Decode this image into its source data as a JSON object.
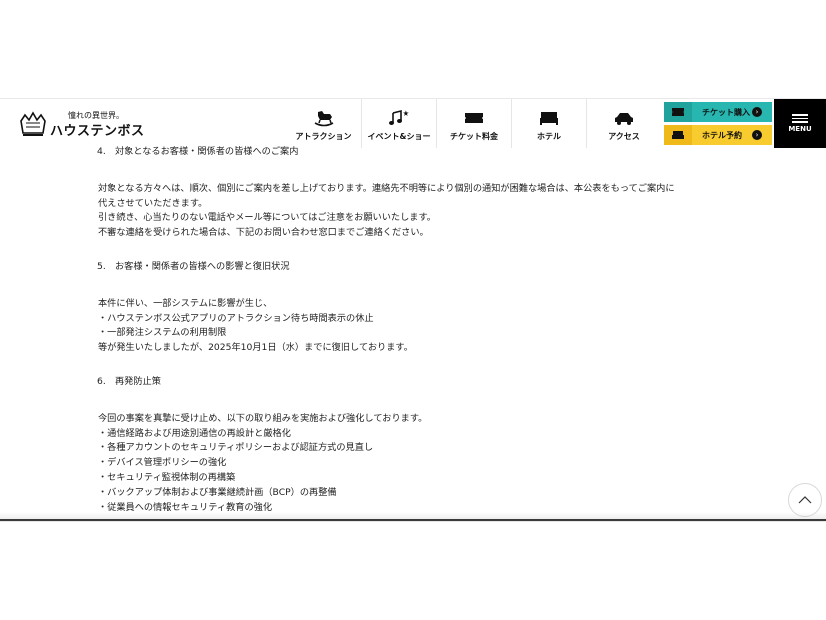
{
  "header": {
    "logo": {
      "tagline": "憧れの異世界。",
      "brand": "ハウステンボス"
    },
    "nav": [
      {
        "label": "アトラクション",
        "icon": "rocking-horse-icon"
      },
      {
        "label": "イベント&ショー",
        "icon": "music-notes-icon"
      },
      {
        "label": "チケット料金",
        "icon": "ticket-icon"
      },
      {
        "label": "ホテル",
        "icon": "bed-icon"
      },
      {
        "label": "アクセス",
        "icon": "car-icon"
      }
    ],
    "cta_ticket": {
      "label": "チケット購入",
      "icon": "ticket-icon",
      "color": "#27b7b0"
    },
    "cta_hotel": {
      "label": "ホテル予約",
      "icon": "bed-icon",
      "color": "#f8cc2e"
    },
    "menu_label": "MENU"
  },
  "sections": {
    "s4_heading": "4.　対象となるお客様・関係者の皆様へのご案内",
    "s4_lines": [
      "対象となる方々へは、順次、個別にご案内を差し上げております。連絡先不明等により個別の通知が困難な場合は、本公表をもってご案内に",
      "代えさせていただきます。",
      "引き続き、心当たりのない電話やメール等についてはご注意をお願いいたします。",
      "不審な連絡を受けられた場合は、下記のお問い合わせ窓口までご連絡ください。"
    ],
    "s5_heading": "5.　お客様・関係者の皆様への影響と復旧状況",
    "s5_lines": [
      "本件に伴い、一部システムに影響が生じ、",
      "・ハウステンボス公式アプリのアトラクション待ち時間表示の休止",
      "・一部発注システムの利用制限",
      "等が発生いたしましたが、2025年10月1日（水）までに復旧しております。"
    ],
    "s6_heading": "6.　再発防止策",
    "s6_lines": [
      "今回の事案を真摯に受け止め、以下の取り組みを実施および強化しております。",
      "・通信経路および用途別通信の再設計と厳格化",
      "・各種アカウントのセキュリティポリシーおよび認証方式の見直し",
      "・デバイス管理ポリシーの強化",
      "・セキュリティ監視体制の再構築",
      "・バックアップ体制および事業継続計画（BCP）の再整備",
      "・従業員への情報セキュリティ教育の強化"
    ]
  },
  "scroll_top_icon": "chevron-up-icon"
}
